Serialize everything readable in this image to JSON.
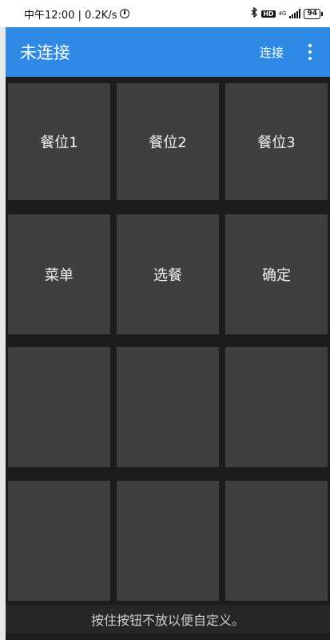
{
  "status_bar": {
    "time_speed": "中午12:00 | 0.2K/s",
    "hd": "HD",
    "network": "4G",
    "battery": "94"
  },
  "app_bar": {
    "title": "未连接",
    "connect_label": "连接"
  },
  "buttons": [
    {
      "label": "餐位1"
    },
    {
      "label": "餐位2"
    },
    {
      "label": "餐位3"
    },
    {
      "label": "菜单"
    },
    {
      "label": "选餐"
    },
    {
      "label": "确定"
    },
    {
      "label": ""
    },
    {
      "label": ""
    },
    {
      "label": ""
    },
    {
      "label": ""
    },
    {
      "label": ""
    },
    {
      "label": ""
    }
  ],
  "footer_hint": "按住按钮不放以便自定义。",
  "colors": {
    "app_bar": "#2f8ae6",
    "cell": "#3f3f3f",
    "background": "#1c1c1c"
  }
}
